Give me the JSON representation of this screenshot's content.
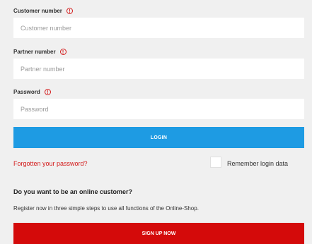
{
  "form": {
    "customer_number": {
      "label": "Customer number",
      "placeholder": "Customer number",
      "value": ""
    },
    "partner_number": {
      "label": "Partner number",
      "placeholder": "Partner number",
      "value": ""
    },
    "password": {
      "label": "Password",
      "placeholder": "Password",
      "value": ""
    },
    "info_icon_glyph": "!",
    "login_label": "LOGIN",
    "forgot_label": "Forgotten your password?",
    "remember_label": "Remember login data",
    "remember_checked": false
  },
  "signup": {
    "heading": "Do you want to be an online customer?",
    "text": "Register now in three simple steps to use all functions of the Online-Shop.",
    "button_label": "SIGN UP NOW"
  },
  "colors": {
    "accent_blue": "#1e9be3",
    "accent_red": "#d40a0a",
    "background": "#f0f0f0"
  },
  "icons": {
    "info": "info-icon"
  }
}
